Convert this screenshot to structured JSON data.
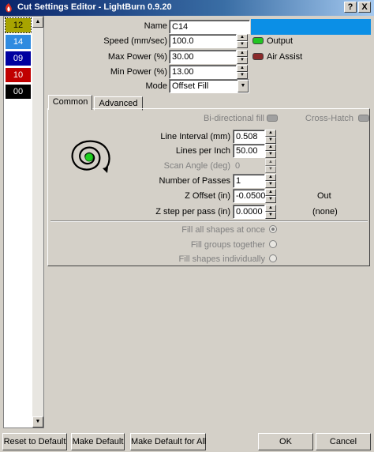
{
  "window": {
    "title": "Cut Settings Editor - LightBurn 0.9.20",
    "help_label": "?",
    "close_label": "X"
  },
  "layers": [
    {
      "label": "12",
      "bg": "#a8a400",
      "fg": "#000000",
      "selected": true
    },
    {
      "label": "14",
      "bg": "#2f8be0",
      "fg": "#ffffff",
      "selected": false
    },
    {
      "label": "09",
      "bg": "#0000a0",
      "fg": "#ffffff",
      "selected": false
    },
    {
      "label": "10",
      "bg": "#c00000",
      "fg": "#ffffff",
      "selected": false
    },
    {
      "label": "00",
      "bg": "#000000",
      "fg": "#ffffff",
      "selected": false
    }
  ],
  "form": {
    "name_label": "Name",
    "name_value": "C14",
    "name_color": "#0b8fe6",
    "speed_label": "Speed (mm/sec)",
    "speed_value": "100.0",
    "max_power_label": "Max Power (%)",
    "max_power_value": "30.00",
    "min_power_label": "Min Power (%)",
    "min_power_value": "13.00",
    "mode_label": "Mode",
    "mode_value": "Offset Fill",
    "output_label": "Output",
    "output_on": true,
    "air_assist_label": "Air Assist",
    "air_assist_on": false
  },
  "tabs": {
    "common": "Common",
    "advanced": "Advanced"
  },
  "common": {
    "bidirectional_label": "Bi-directional fill",
    "crosshatch_label": "Cross-Hatch",
    "line_interval_label": "Line Interval (mm)",
    "line_interval_value": "0.508",
    "lines_per_inch_label": "Lines per Inch",
    "lines_per_inch_value": "50.00",
    "scan_angle_label": "Scan Angle (deg)",
    "scan_angle_value": "0",
    "passes_label": "Number of Passes",
    "passes_value": "1",
    "z_offset_label": "Z Offset (in)",
    "z_offset_value": "-0.0500",
    "z_offset_dir": "Out",
    "z_step_label": "Z step per pass (in)",
    "z_step_value": "0.0000",
    "z_step_note": "(none)",
    "fill_all_label": "Fill all shapes at once",
    "fill_groups_label": "Fill groups together",
    "fill_individual_label": "Fill shapes individually"
  },
  "buttons": {
    "reset": "Reset to Default",
    "make_default": "Make Default",
    "make_default_all": "Make Default for All",
    "ok": "OK",
    "cancel": "Cancel"
  }
}
